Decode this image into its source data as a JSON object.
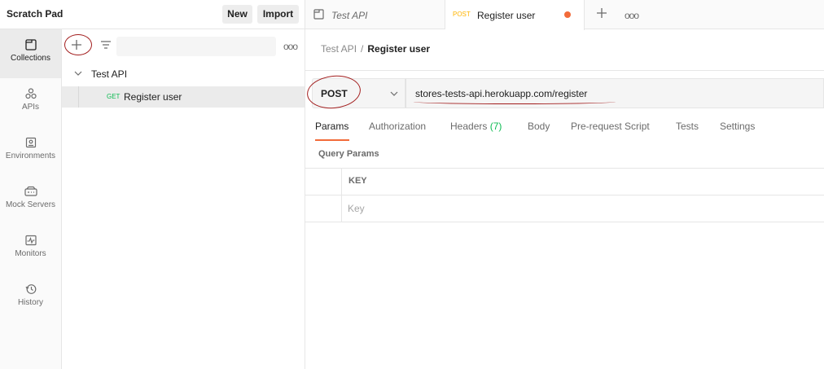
{
  "workspace": {
    "title": "Scratch Pad",
    "new_label": "New",
    "import_label": "Import"
  },
  "rail": {
    "items": [
      {
        "label": "Collections",
        "icon": "collections-icon",
        "active": true
      },
      {
        "label": "APIs",
        "icon": "apis-icon",
        "active": false
      },
      {
        "label": "Environments",
        "icon": "environments-icon",
        "active": false
      },
      {
        "label": "Mock Servers",
        "icon": "mock-servers-icon",
        "active": false
      },
      {
        "label": "Monitors",
        "icon": "monitors-icon",
        "active": false
      },
      {
        "label": "History",
        "icon": "history-icon",
        "active": false
      }
    ]
  },
  "collections": {
    "more_label": "ooo",
    "root": {
      "label": "Test API"
    },
    "request": {
      "method": "GET",
      "label": "Register user"
    }
  },
  "tabs": [
    {
      "label": "Test API",
      "icon": "collection-icon"
    },
    {
      "method": "POST",
      "label": "Register user",
      "unsaved": true
    }
  ],
  "tabbar": {
    "more_label": "ooo"
  },
  "breadcrumb": {
    "parent": "Test API",
    "separator": "/",
    "current": "Register user"
  },
  "request": {
    "method": "POST",
    "url": "stores-tests-api.herokuapp.com/register"
  },
  "subtabs": {
    "params": "Params",
    "authorization": "Authorization",
    "headers": "Headers",
    "headers_count": "(7)",
    "body": "Body",
    "prerequest": "Pre-request Script",
    "tests": "Tests",
    "settings": "Settings"
  },
  "query_params": {
    "title": "Query Params",
    "key_header": "KEY",
    "key_placeholder": "Key"
  },
  "colors": {
    "accent": "#f26b3a",
    "get_method": "#0cbb52",
    "post_method": "#ffb400",
    "annotation": "#a21d1d"
  }
}
